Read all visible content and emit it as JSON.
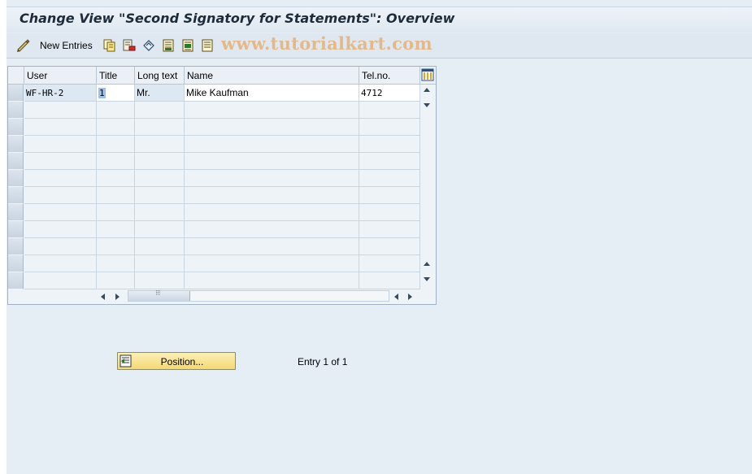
{
  "window": {
    "title": "Change View \"Second Signatory for Statements\": Overview"
  },
  "toolbar": {
    "new_entries_label": "New Entries",
    "icons": [
      "edit-glasses-icon",
      "copy-icon",
      "delete-icon",
      "undo-icon",
      "select-all-icon",
      "select-block-icon",
      "deselect-all-icon"
    ]
  },
  "watermark": "www.tutorialkart.com",
  "table": {
    "columns": [
      "User",
      "Title",
      "Long text",
      "Name",
      "Tel.no."
    ],
    "rows": [
      {
        "user": "WF-HR-2",
        "title": "1",
        "long_text": "Mr.",
        "name": "Mike Kaufman",
        "tel": "4712"
      }
    ],
    "empty_rows": 11
  },
  "footer": {
    "position_button_label": "Position...",
    "entry_info": "Entry 1 of 1"
  },
  "colors": {
    "background": "#e5edf5",
    "title_bar": "#dfe8f1",
    "button_yellow": "#f3d873",
    "watermark": "#e3b98a"
  }
}
